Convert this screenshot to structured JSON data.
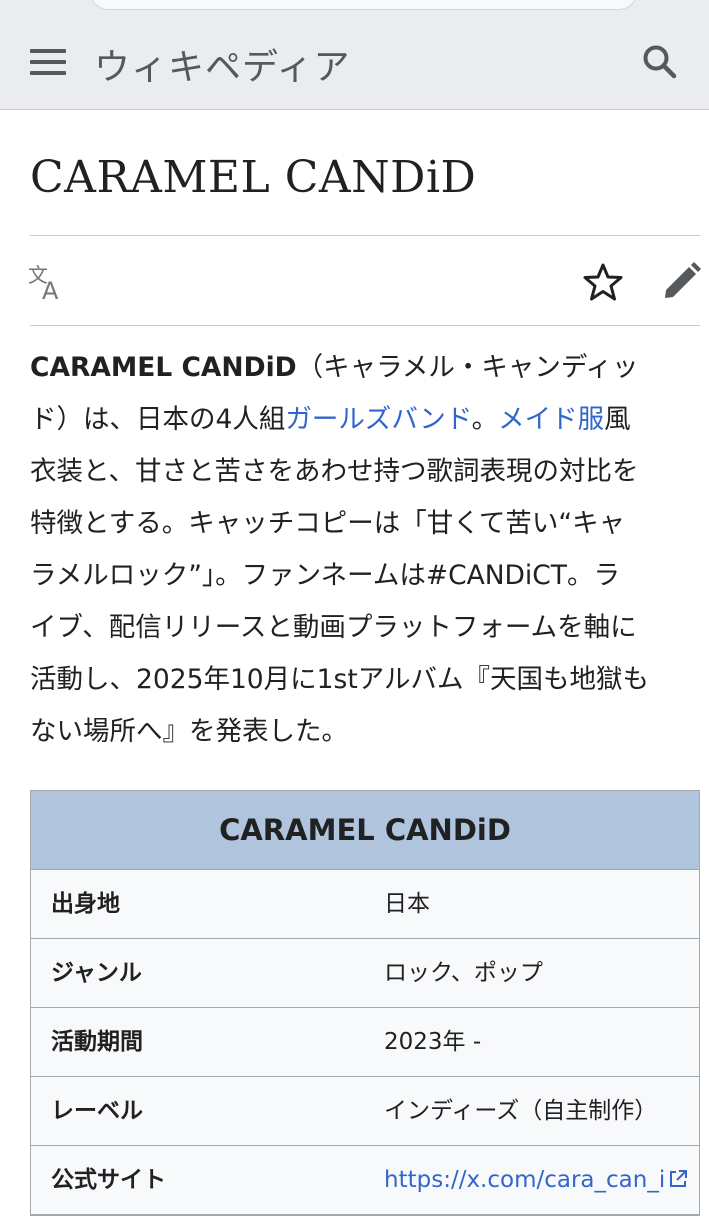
{
  "header": {
    "wordmark": "ウィキペディア",
    "menu_icon": "hamburger-menu-icon",
    "search_icon": "search-icon",
    "background_color": "#eaecf0"
  },
  "page": {
    "title": "CARAMEL CANDiD",
    "actions": {
      "language_icon": "translate-icon",
      "watch_icon": "star-icon",
      "edit_icon": "pencil-icon"
    }
  },
  "article": {
    "line1": {
      "bold": "CARAMEL CANDiD",
      "rest": "（キャラメル・キャンディッ"
    },
    "line2": {
      "pre": "ド）は、日本の4人組",
      "link1": "ガールズバンド",
      "mid": "。",
      "link2": "メイド服",
      "post": "風"
    },
    "line3": "衣装と、甘さと苦さをあわせ持つ歌詞表現の対比を",
    "line4": "特徴とする。キャッチコピーは「甘くて苦い“キャ",
    "line5": "ラメルロック”」。ファンネームは#CANDiCT。ラ",
    "line6": "イブ、配信リリースと動画プラットフォームを軸に",
    "line7": "活動し、2025年10月に1stアルバム『天国も地獄も",
    "line8": "ない場所へ』を発表した。",
    "link_color": "#3366cc"
  },
  "infobox": {
    "title": "CARAMEL CANDiD",
    "title_bg": "#b0c4de",
    "rows": [
      {
        "label": "出身地",
        "value": "日本"
      },
      {
        "label": "ジャンル",
        "value": "ロック、ポップ"
      },
      {
        "label": "活動期間",
        "value": "2023年 -"
      },
      {
        "label": "レーベル",
        "value": "インディーズ（自主制作）"
      },
      {
        "label": "公式サイト",
        "value": "https://x.com/cara_can_i",
        "external_icon": "external-link-icon"
      }
    ]
  }
}
